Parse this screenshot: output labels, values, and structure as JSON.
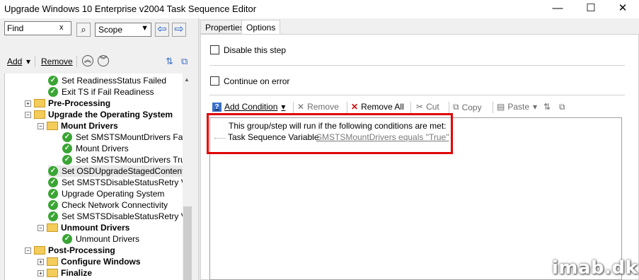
{
  "window": {
    "title": "Upgrade Windows 10 Enterprise v2004 Task Sequence Editor",
    "minimize": "—",
    "maximize": "☐",
    "close": "✕"
  },
  "search": {
    "find_value": "Find",
    "clear": "x",
    "scope_value": "Scope",
    "scope_arrow": "▼"
  },
  "tree_toolbar": {
    "add_label": "Add",
    "add_arrow": "▾",
    "remove_label": "Remove"
  },
  "tree": {
    "items": [
      {
        "label": "Set ReadinessStatus Failed"
      },
      {
        "label": "Exit TS if Fail Readiness"
      },
      {
        "label": "Pre-Processing"
      },
      {
        "label": "Upgrade the Operating System"
      },
      {
        "label": "Mount Drivers"
      },
      {
        "label": "Set SMSTSMountDrivers False"
      },
      {
        "label": "Mount Drivers"
      },
      {
        "label": "Set SMSTSMountDrivers True"
      },
      {
        "label": "Set OSDUpgradeStagedContent"
      },
      {
        "label": "Set SMSTSDisableStatusRetry Varia"
      },
      {
        "label": "Upgrade Operating System"
      },
      {
        "label": "Check Network Connectivity"
      },
      {
        "label": "Set SMSTSDisableStatusRetry Varia"
      },
      {
        "label": "Unmount Drivers"
      },
      {
        "label": "Unmount Drivers"
      },
      {
        "label": "Post-Processing"
      },
      {
        "label": "Configure Windows"
      },
      {
        "label": "Finalize"
      }
    ]
  },
  "tabs": [
    {
      "label": "Properties"
    },
    {
      "label": "Options"
    }
  ],
  "options": {
    "disable_label": "Disable this step",
    "continue_label": "Continue on error"
  },
  "conditions_toolbar": {
    "add_condition": "Add Condition",
    "add_arrow": "▾",
    "remove": "Remove",
    "remove_all": "Remove All",
    "cut": "Cut",
    "copy": "Copy",
    "paste": "Paste",
    "paste_arrow": "▾"
  },
  "conditions": {
    "header": "This group/step will run if the following conditions are met:",
    "variable_label": "Task Sequence Variable",
    "variable_value": "SMSTSMountDrivers equals \"True\""
  },
  "watermark": "imab.dk",
  "colors": {
    "highlight": "#e00000",
    "check_green": "#3aa534",
    "folder_yellow": "#f3cc5a",
    "link_gray": "#7a7a7a"
  }
}
